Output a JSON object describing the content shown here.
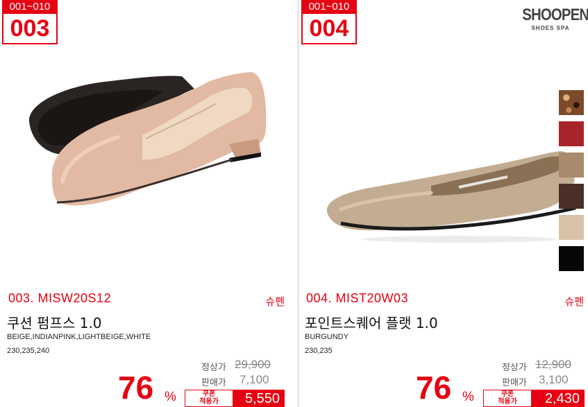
{
  "products": [
    {
      "badge_range": "001~010",
      "badge_number": "003",
      "code": "003. MISW20S12",
      "brand_tag": "슈펜",
      "name": "쿠션 펌프스 1.0",
      "colors": "BEIGE,INDIANPINK,LIGHTBEIGE,WHITE",
      "sizes": "230,235,240",
      "discount_pct": "76",
      "pct_sign": "%",
      "regular_label": "정상가",
      "regular_price": "29,900",
      "sale_label": "판매가",
      "sale_price": "7,100",
      "coupon_label_1": "쿠폰",
      "coupon_label_2": "적용가",
      "coupon_price": "5,550"
    },
    {
      "badge_range": "001~010",
      "badge_number": "004",
      "logo_main": "SHOOPEN",
      "logo_sub": "SHOES SPA",
      "code": "004. MIST20W03",
      "brand_tag": "슈펜",
      "name": "포인트스퀘어 플랫 1.0",
      "colors": "BURGUNDY",
      "sizes": "230,235",
      "discount_pct": "76",
      "pct_sign": "%",
      "regular_label": "정상가",
      "regular_price": "12,900",
      "sale_label": "판매가",
      "sale_price": "3,100",
      "coupon_label_1": "쿠폰",
      "coupon_label_2": "적용가",
      "coupon_price": "2,430",
      "swatch_colors": [
        "#7a4a2a",
        "#a8242a",
        "#a98a6c",
        "#4a2e28",
        "#d8c2a8",
        "#070707"
      ]
    }
  ],
  "theme": {
    "accent": "#e60012"
  }
}
